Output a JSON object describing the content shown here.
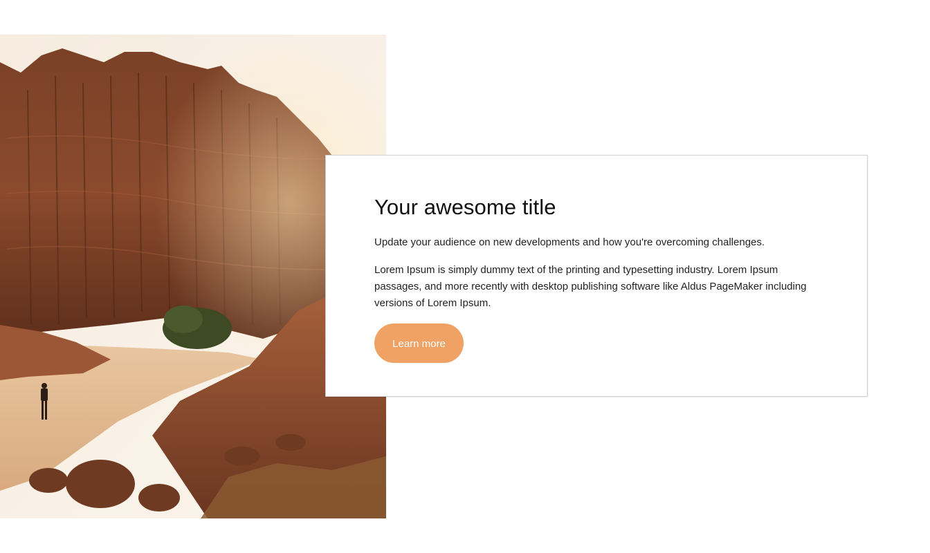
{
  "hero": {
    "image_icon": "canyon-photo"
  },
  "card": {
    "title": "Your awesome title",
    "subtitle": "Update your audience on new developments and how you're overcoming challenges.",
    "body": "Lorem Ipsum is simply dummy text of the printing and typesetting industry. Lorem Ipsum passages, and more recently with desktop publishing software like Aldus PageMaker including versions of Lorem Ipsum.",
    "button_label": "Learn more",
    "button_color": "#f0a265"
  }
}
